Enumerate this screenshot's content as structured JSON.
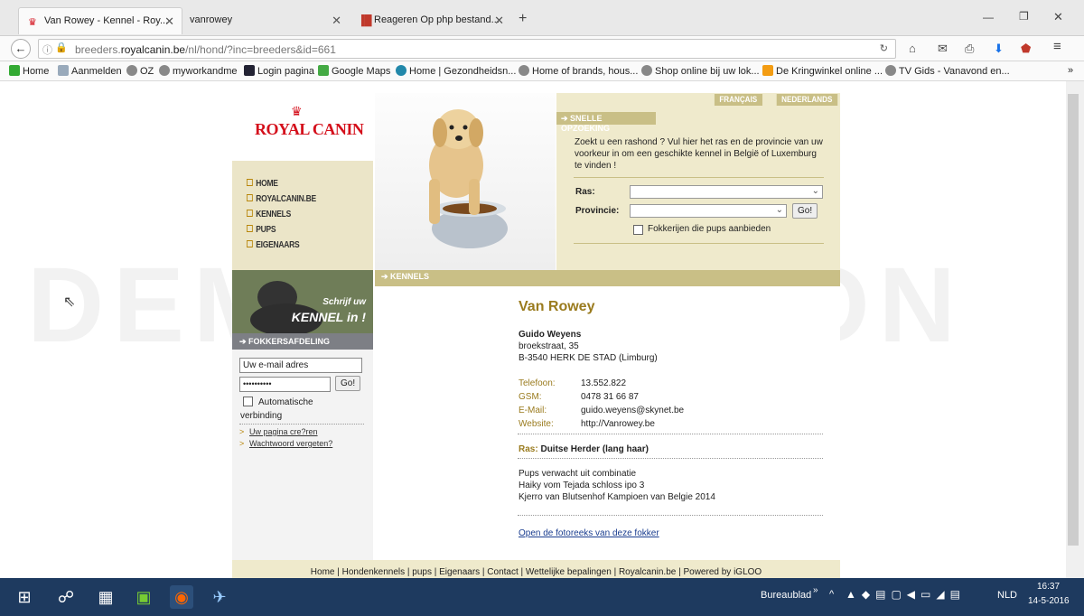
{
  "browser": {
    "tabs": [
      {
        "label": "Van Rowey - Kennel - Roy...",
        "active": true
      },
      {
        "label": "vanrowey",
        "active": false
      },
      {
        "label": "Reageren Op php bestand...",
        "active": false
      }
    ],
    "new_tab": "+",
    "url_prefix": "breeders.",
    "url_domain": "royalcanin.be",
    "url_path": "/nl/hond/?inc=breeders&id=661",
    "bookmarks": [
      "Home",
      "Aanmelden",
      "OZ",
      "myworkandme",
      "Login pagina",
      "Google Maps",
      "Home | Gezondheidsn...",
      "Home of brands, hous...",
      "Shop online bij uw lok...",
      "De Kringwinkel online ...",
      "TV Gids - Vanavond en..."
    ],
    "bookmarks_more": "»"
  },
  "watermark": "DEMO VERSION",
  "site": {
    "logo": "ROYAL CANIN",
    "menu": [
      "HOME",
      "ROYALCANIN.BE",
      "KENNELS",
      "PUPS",
      "EIGENAARS"
    ],
    "lang": [
      "FRANÇAIS",
      "NEDERLANDS"
    ],
    "quick_search_title": "SNELLE OPZOEKING",
    "quick_search_text": "Zoekt u een rashond ? Vul hier het ras en de provincie van uw voorkeur in om een geschikte kennel in België of Luxemburg te vinden !",
    "ras_label": "Ras:",
    "provincie_label": "Provincie:",
    "go_label": "Go!",
    "pups_checkbox": "Fokkerijen die pups aanbieden",
    "banner": {
      "line1": "Schrijf uw",
      "line2": "KENNEL in !"
    },
    "kennels_bar": "KENNELS",
    "fokker_hdr": "FOKKERSAFDELING",
    "email_placeholder": "Uw e-mail adres",
    "password_mask": "••••••••••",
    "auto_login": "Automatische verbinding",
    "links": [
      "Uw pagina cre?ren",
      "Wachtwoord vergeten?"
    ],
    "kennel_name": "Van Rowey",
    "owner": "Guido Weyens",
    "street": "broekstraat, 35",
    "city": "B-3540 HERK DE STAD (Limburg)",
    "contact": [
      {
        "label": "Telefoon:",
        "value": "13.552.822"
      },
      {
        "label": "GSM:",
        "value": "0478 31 66 87"
      },
      {
        "label": "E-Mail:",
        "value": "guido.weyens@skynet.be"
      },
      {
        "label": "Website:",
        "value": "http://Vanrowey.be"
      }
    ],
    "ras_detail_label": "Ras:",
    "ras_detail_value": "Duitse Herder (lang haar)",
    "pups_text": [
      "Pups verwacht uit combinatie",
      "Haiky vom Tejada schloss ipo 3",
      "Kjerro van Blutsenhof Kampioen van Belgie 2014"
    ],
    "photo_link": "Open de fotoreeks van deze fokker",
    "footer": "Home | Hondenkennels | pups | Eigenaars | Contact | Wettelijke bepalingen | Royalcanin.be | Powered by iGLOO"
  },
  "taskbar": {
    "desktop": "Bureaublad",
    "lang": "NLD",
    "time": "16:37",
    "date": "14-5-2016"
  }
}
